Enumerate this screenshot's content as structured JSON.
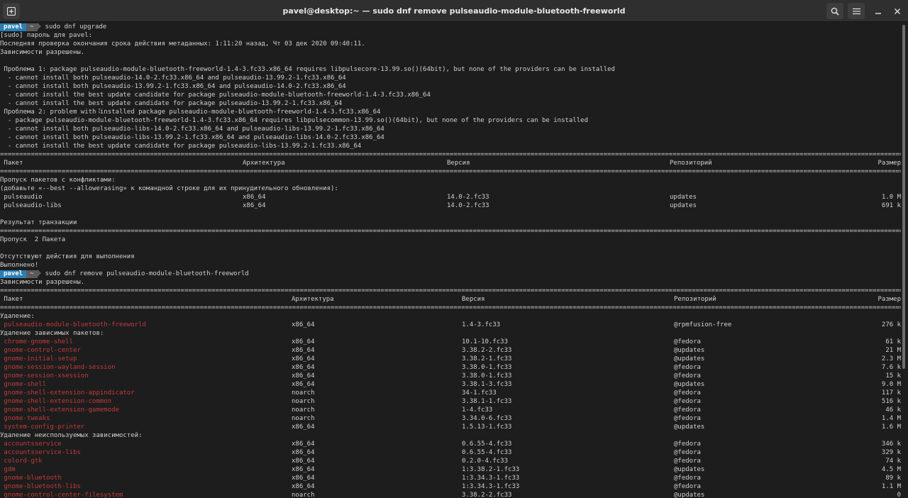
{
  "window": {
    "title": "pavel@desktop:~ — sudo dnf remove pulseaudio-module-bluetooth-freeworld",
    "icons": {
      "new_tab": "plus-square-icon",
      "search": "search-icon",
      "menu": "hamburger-menu-icon",
      "minimize": "minimize-icon",
      "close": "close-icon"
    }
  },
  "prompt": {
    "user": "pavel",
    "dir": "~"
  },
  "colors": {
    "prompt_user_bg": "#2a7fb4",
    "prompt_dir_bg": "#5a5a5a",
    "package_red": "#c23b3b",
    "bg": "#1d1d1d"
  },
  "session1": {
    "command": "sudo dnf upgrade",
    "lines": [
      "[sudo] пароль для pavel:",
      "Последняя проверка окончания срока действия метаданных: 1:11:20 назад, Чт 03 дек 2020 09:40:11.",
      "Зависимости разрешены.",
      "",
      " Проблема 1: package pulseaudio-module-bluetooth-freeworld-1.4-3.fc33.x86_64 requires libpulsecore-13.99.so()(64bit), but none of the providers can be installed",
      "  - cannot install both pulseaudio-14.0-2.fc33.x86_64 and pulseaudio-13.99.2-1.fc33.x86_64",
      "  - cannot install both pulseaudio-13.99.2-1.fc33.x86_64 and pulseaudio-14.0-2.fc33.x86_64",
      "  - cannot install the best update candidate for package pulseaudio-module-bluetooth-freeworld-1.4-3.fc33.x86_64",
      "  - cannot install the best update candidate for package pulseaudio-13.99.2-1.fc33.x86_64",
      " Проблема 2: problem with installed package pulseaudio-module-bluetooth-freeworld-1.4-3.fc33.x86_64",
      "  - package pulseaudio-module-bluetooth-freeworld-1.4-3.fc33.x86_64 requires libpulsecommon-13.99.so()(64bit), but none of the providers can be installed",
      "  - cannot install both pulseaudio-libs-14.0-2.fc33.x86_64 and pulseaudio-libs-13.99.2-1.fc33.x86_64",
      "  - cannot install both pulseaudio-libs-13.99.2-1.fc33.x86_64 and pulseaudio-libs-14.0-2.fc33.x86_64",
      "  - cannot install the best update candidate for package pulseaudio-libs-13.99.2-1.fc33.x86_64"
    ],
    "headers": {
      "pkg": " Пакет",
      "arch": "Архитектура",
      "ver": "Версия",
      "repo": "Репозиторий",
      "size": "Размер"
    },
    "skip_heading_1": "Пропуск пакетов с конфликтами:",
    "skip_heading_2": "(добавьте «--best --allowerasing» к командной строке для их принудительного обновления):",
    "skipped": [
      {
        "pkg": " pulseaudio",
        "arch": "x86_64",
        "ver": "14.0-2.fc33",
        "repo": "updates",
        "size": "1.0 M"
      },
      {
        "pkg": " pulseaudio-libs",
        "arch": "x86_64",
        "ver": "14.0-2.fc33",
        "repo": "updates",
        "size": "691 k"
      }
    ],
    "summary_heading": "Результат транзакции",
    "summary_line": "Пропуск  2 Пакета",
    "nothing": "Отсутствуют действия для выполнения",
    "done": "Выполнено!"
  },
  "session2": {
    "command": "sudo dnf remove pulseaudio-module-bluetooth-freeworld",
    "resolved": "Зависимости разрешены.",
    "headers": {
      "pkg": " Пакет",
      "arch": "Архитектура",
      "ver": "Версия",
      "repo": "Репозиторий",
      "size": "Размер"
    },
    "removing": "Удаление:",
    "removing_deps": "Удаление зависимых пакетов:",
    "removing_unused": "Удаление неиспользуемых зависимостей:",
    "main": [
      {
        "pkg": " pulseaudio-module-bluetooth-freeworld",
        "arch": "x86_64",
        "ver": "1.4-3.fc33",
        "repo": "@rpmfusion-free",
        "size": "276 k"
      }
    ],
    "deps": [
      {
        "pkg": " chrome-gnome-shell",
        "arch": "x86_64",
        "ver": "10.1-10.fc33",
        "repo": "@fedora",
        "size": "61 k"
      },
      {
        "pkg": " gnome-control-center",
        "arch": "x86_64",
        "ver": "3.38.2-2.fc33",
        "repo": "@updates",
        "size": "21 M"
      },
      {
        "pkg": " gnome-initial-setup",
        "arch": "x86_64",
        "ver": "3.38.2-1.fc33",
        "repo": "@updates",
        "size": "2.3 M"
      },
      {
        "pkg": " gnome-session-wayland-session",
        "arch": "x86_64",
        "ver": "3.38.0-1.fc33",
        "repo": "@fedora",
        "size": "7.6 k"
      },
      {
        "pkg": " gnome-session-xsession",
        "arch": "x86_64",
        "ver": "3.38.0-1.fc33",
        "repo": "@fedora",
        "size": "15 k"
      },
      {
        "pkg": " gnome-shell",
        "arch": "x86_64",
        "ver": "3.38.1-3.fc33",
        "repo": "@updates",
        "size": "9.0 M"
      },
      {
        "pkg": " gnome-shell-extension-appindicator",
        "arch": "noarch",
        "ver": "34-1.fc33",
        "repo": "@fedora",
        "size": "117 k"
      },
      {
        "pkg": " gnome-shell-extension-common",
        "arch": "noarch",
        "ver": "3.38.1-1.fc33",
        "repo": "@fedora",
        "size": "516 k"
      },
      {
        "pkg": " gnome-shell-extension-gamemode",
        "arch": "noarch",
        "ver": "1-4.fc33",
        "repo": "@fedora",
        "size": "46 k"
      },
      {
        "pkg": " gnome-tweaks",
        "arch": "noarch",
        "ver": "3.34.0-6.fc33",
        "repo": "@fedora",
        "size": "1.4 M"
      },
      {
        "pkg": " system-config-printer",
        "arch": "x86_64",
        "ver": "1.5.13-1.fc33",
        "repo": "@updates",
        "size": "1.6 M"
      }
    ],
    "unused": [
      {
        "pkg": " accountsservice",
        "arch": "x86_64",
        "ver": "0.6.55-4.fc33",
        "repo": "@fedora",
        "size": "346 k"
      },
      {
        "pkg": " accountsservice-libs",
        "arch": "x86_64",
        "ver": "0.6.55-4.fc33",
        "repo": "@fedora",
        "size": "329 k"
      },
      {
        "pkg": " colord-gtk",
        "arch": "x86_64",
        "ver": "0.2.0-4.fc33",
        "repo": "@fedora",
        "size": "74 k"
      },
      {
        "pkg": " gdm",
        "arch": "x86_64",
        "ver": "1:3.38.2-1.fc33",
        "repo": "@updates",
        "size": "4.5 M"
      },
      {
        "pkg": " gnome-bluetooth",
        "arch": "x86_64",
        "ver": "1:3.34.3-1.fc33",
        "repo": "@fedora",
        "size": "89 k"
      },
      {
        "pkg": " gnome-bluetooth-libs",
        "arch": "x86_64",
        "ver": "1:3.34.3-1.fc33",
        "repo": "@fedora",
        "size": "1.1 M"
      },
      {
        "pkg": " gnome-control-center-filesystem",
        "arch": "noarch",
        "ver": "3.38.2-2.fc33",
        "repo": "@updates",
        "size": "0"
      }
    ]
  }
}
